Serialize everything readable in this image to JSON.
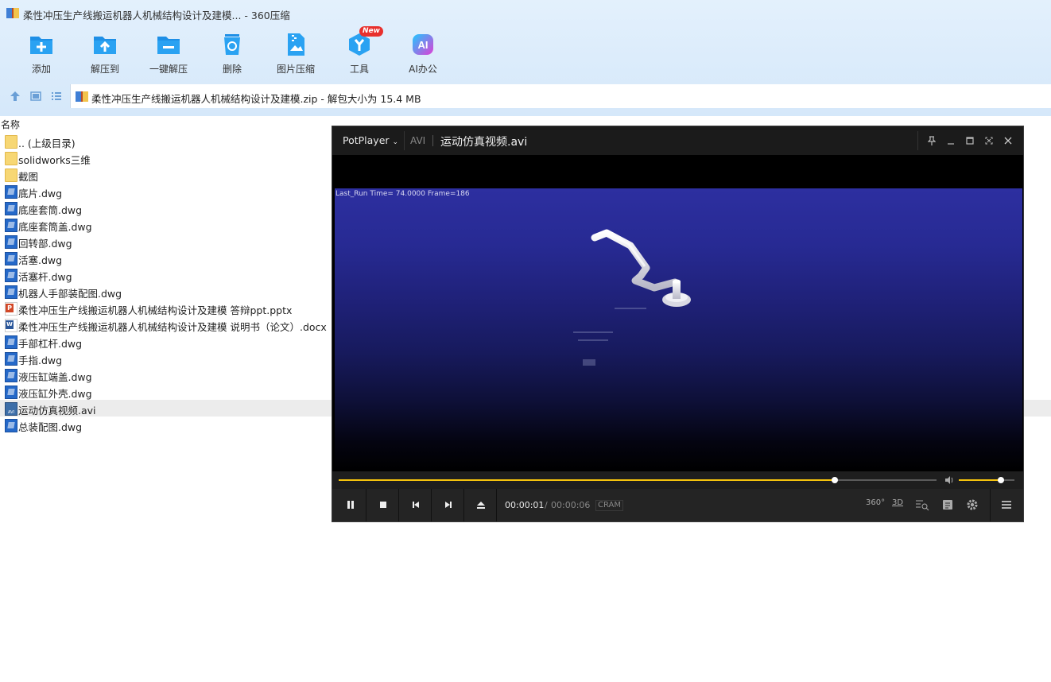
{
  "window": {
    "title": "柔性冲压生产线搬运机器人机械结构设计及建模... - 360压缩"
  },
  "toolbar": {
    "buttons": [
      {
        "label": "添加",
        "icon": "add-icon"
      },
      {
        "label": "解压到",
        "icon": "extract-to-icon"
      },
      {
        "label": "一键解压",
        "icon": "one-click-extract-icon"
      },
      {
        "label": "删除",
        "icon": "delete-icon"
      },
      {
        "label": "图片压缩",
        "icon": "image-compress-icon"
      },
      {
        "label": "工具",
        "icon": "tools-icon",
        "badge": "New"
      },
      {
        "label": "AI办公",
        "icon": "ai-office-icon",
        "glyph": "AI"
      }
    ]
  },
  "address": {
    "path": "柔性冲压生产线搬运机器人机械结构设计及建模.zip - 解包大小为 15.4 MB"
  },
  "filelist": {
    "column_name": "名称",
    "items": [
      {
        "name": ".. (上级目录)",
        "type": "folder"
      },
      {
        "name": "solidworks三维",
        "type": "folder"
      },
      {
        "name": "截图",
        "type": "folder"
      },
      {
        "name": "底片.dwg",
        "type": "dwg"
      },
      {
        "name": "底座套筒.dwg",
        "type": "dwg"
      },
      {
        "name": "底座套筒盖.dwg",
        "type": "dwg"
      },
      {
        "name": "回转部.dwg",
        "type": "dwg"
      },
      {
        "name": "活塞.dwg",
        "type": "dwg"
      },
      {
        "name": "活塞杆.dwg",
        "type": "dwg"
      },
      {
        "name": "机器人手部装配图.dwg",
        "type": "dwg"
      },
      {
        "name": "柔性冲压生产线搬运机器人机械结构设计及建模 答辩ppt.pptx",
        "type": "pptx"
      },
      {
        "name": "柔性冲压生产线搬运机器人机械结构设计及建模 说明书（论文）.docx",
        "type": "docx"
      },
      {
        "name": "手部杠杆.dwg",
        "type": "dwg"
      },
      {
        "name": "手指.dwg",
        "type": "dwg"
      },
      {
        "name": "液压缸端盖.dwg",
        "type": "dwg"
      },
      {
        "name": "液压缸外壳.dwg",
        "type": "dwg"
      },
      {
        "name": "运动仿真视频.avi",
        "type": "avi",
        "selected": true
      },
      {
        "name": "总装配图.dwg",
        "type": "dwg"
      }
    ]
  },
  "player": {
    "app_name": "PotPlayer",
    "format": "AVI",
    "file": "运动仿真视频.avi",
    "overlay": "Last_Run   Time= 74.0000  Frame=186",
    "current_time": "00:00:01",
    "separator": "/",
    "total_time": "00:00:06",
    "codec": "CRAM",
    "seek_progress": 0.83,
    "volume": 0.75,
    "right_buttons": [
      "360°",
      "3D"
    ]
  }
}
